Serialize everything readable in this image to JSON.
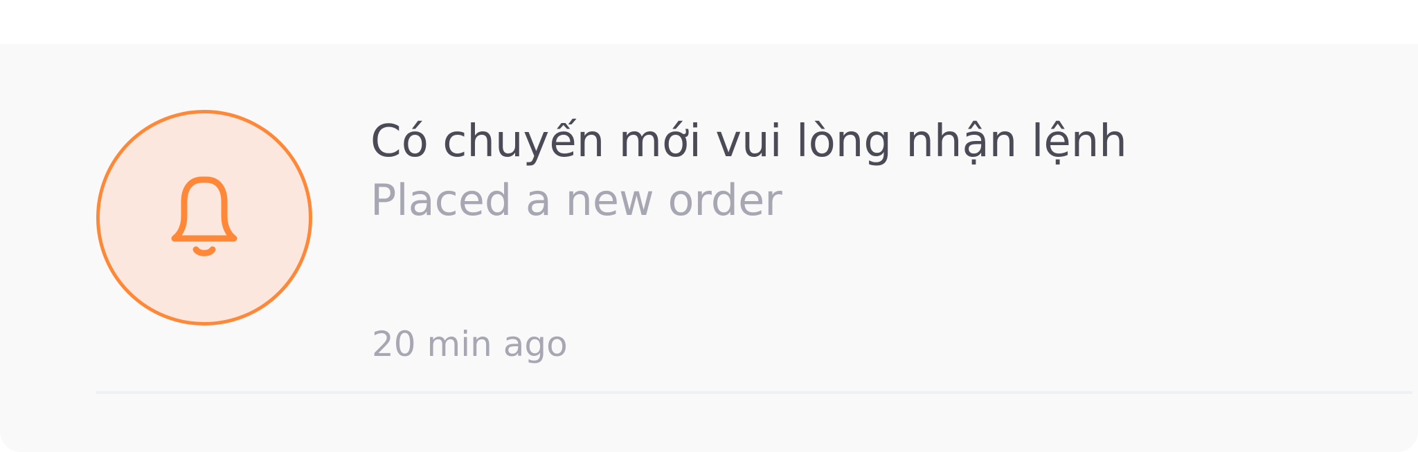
{
  "notification": {
    "icon": "bell-icon",
    "title": "Có chuyến mới vui lòng nhận lệnh",
    "subtitle": "Placed a new order",
    "time": "20 min ago",
    "accent_color": "#ff8838",
    "icon_background": "#fbe7de"
  }
}
